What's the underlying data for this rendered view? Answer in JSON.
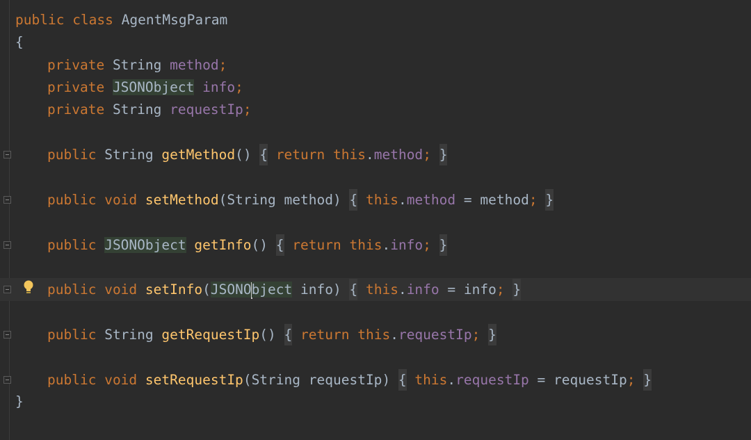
{
  "code": {
    "kw_public": "public",
    "kw_class": "class",
    "kw_private": "private",
    "kw_void": "void",
    "kw_return": "return",
    "kw_this": "this",
    "class_name": "AgentMsgParam",
    "type_string": "String",
    "type_json": "JSONObject",
    "type_json_a": "JSONO",
    "type_json_b": "bject",
    "field_method": "method",
    "field_info": "info",
    "field_requestip": "requestIp",
    "fn_get_method": "getMethod",
    "fn_set_method": "setMethod",
    "fn_get_info": "getInfo",
    "fn_set_info": "setInfo",
    "fn_get_requestip": "getRequestIp",
    "fn_set_requestip": "setRequestIp",
    "open_brace": "{",
    "close_brace": "}"
  },
  "colors": {
    "background": "#2b2b2b",
    "keyword": "#cc7832",
    "function": "#ffc66d",
    "field": "#9876aa",
    "default_text": "#a9b7c6"
  },
  "icons": {
    "fold": "fold-icon",
    "intention": "lightbulb-icon"
  }
}
